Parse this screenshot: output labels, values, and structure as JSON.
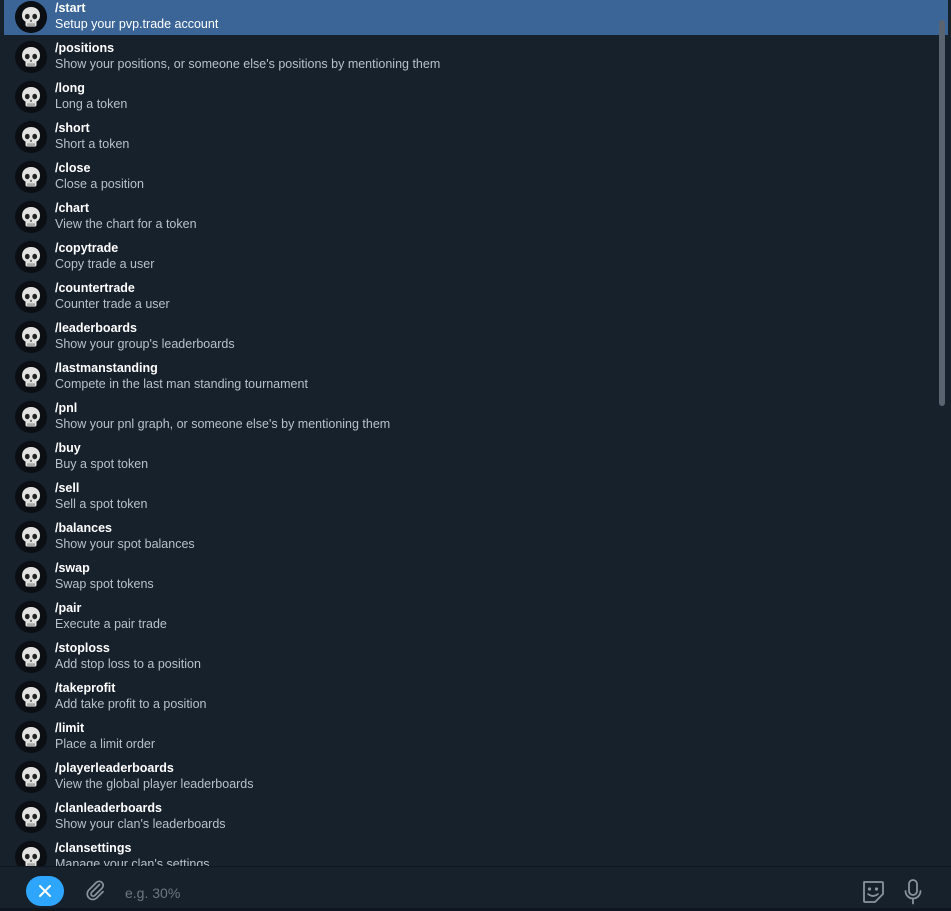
{
  "commands": [
    {
      "name": "/start",
      "description": "Setup your pvp.trade account"
    },
    {
      "name": "/positions",
      "description": "Show your positions, or someone else's positions by mentioning them"
    },
    {
      "name": "/long",
      "description": "Long a token"
    },
    {
      "name": "/short",
      "description": "Short a token"
    },
    {
      "name": "/close",
      "description": "Close a position"
    },
    {
      "name": "/chart",
      "description": "View the chart for a token"
    },
    {
      "name": "/copytrade",
      "description": "Copy trade a user"
    },
    {
      "name": "/countertrade",
      "description": "Counter trade a user"
    },
    {
      "name": "/leaderboards",
      "description": "Show your group's leaderboards"
    },
    {
      "name": "/lastmanstanding",
      "description": "Compete in the last man standing tournament"
    },
    {
      "name": "/pnl",
      "description": "Show your pnl graph, or someone else's by mentioning them"
    },
    {
      "name": "/buy",
      "description": "Buy a spot token"
    },
    {
      "name": "/sell",
      "description": "Sell a spot token"
    },
    {
      "name": "/balances",
      "description": "Show your spot balances"
    },
    {
      "name": "/swap",
      "description": "Swap spot tokens"
    },
    {
      "name": "/pair",
      "description": "Execute a pair trade"
    },
    {
      "name": "/stoploss",
      "description": "Add stop loss to a position"
    },
    {
      "name": "/takeprofit",
      "description": "Add take profit to a position"
    },
    {
      "name": "/limit",
      "description": "Place a limit order"
    },
    {
      "name": "/playerleaderboards",
      "description": "View the global player leaderboards"
    },
    {
      "name": "/clanleaderboards",
      "description": "Show your clan's leaderboards"
    },
    {
      "name": "/clansettings",
      "description": "Manage your clan's settings"
    }
  ],
  "selected_index": 0,
  "composer": {
    "placeholder": "e.g. 30%",
    "value": ""
  },
  "icons": {
    "command_avatar": "skull-icon",
    "cancel": "close-icon",
    "attach": "paperclip-icon",
    "sticker": "sticker-icon",
    "voice": "microphone-icon"
  },
  "colors": {
    "background": "#17212b",
    "selected_row": "#3a6596",
    "accent": "#2ea6ff",
    "command_text": "#ffffff",
    "description_text": "#b8c1cb",
    "placeholder_text": "#6d7883"
  }
}
